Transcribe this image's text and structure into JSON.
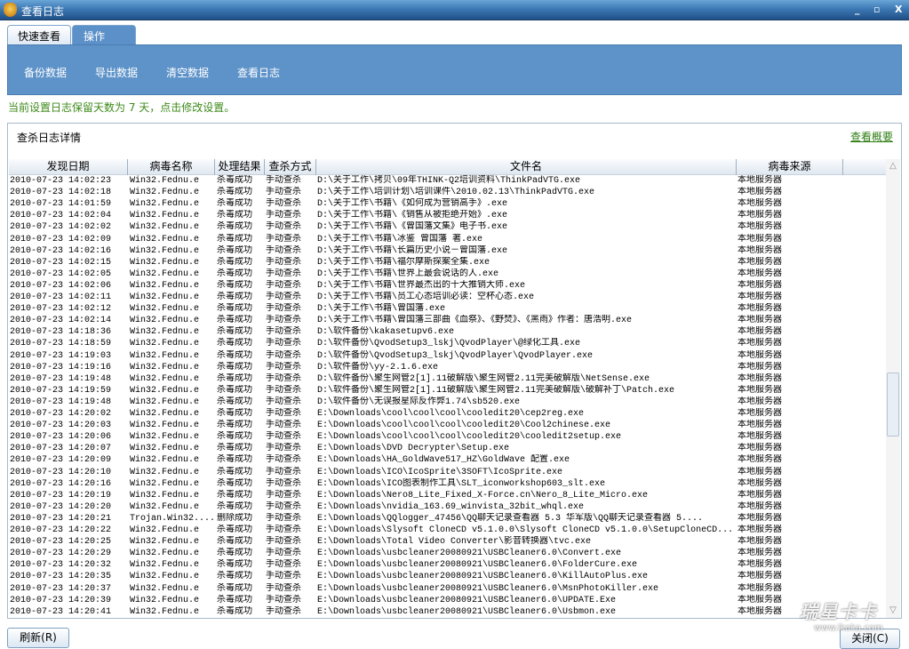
{
  "window": {
    "title": "查看日志",
    "minimize": "_",
    "restore": "▫",
    "close": "X"
  },
  "tabs": [
    {
      "label": "快速查看"
    },
    {
      "label": "操作"
    }
  ],
  "toolbar": [
    "备份数据",
    "导出数据",
    "清空数据",
    "查看日志"
  ],
  "notice": "当前设置日志保留天数为 7 天，点击修改设置。",
  "detail": {
    "title": "查杀日志详情",
    "summary_link": "查看概要"
  },
  "columns": [
    "发现日期",
    "病毒名称",
    "处理结果",
    "查杀方式",
    "文件名",
    "病毒来源"
  ],
  "rows": [
    [
      "2010-07-23 14:02:23",
      "Win32.Fednu.e",
      "杀毒成功",
      "手动查杀",
      "D:\\关于工作\\拷贝\\09年THINK-Q2培训资料\\ThinkPadVTG.exe",
      "本地服务器"
    ],
    [
      "2010-07-23 14:02:18",
      "Win32.Fednu.e",
      "杀毒成功",
      "手动查杀",
      "D:\\关于工作\\培训计划\\培训课件\\2010.02.13\\ThinkPadVTG.exe",
      "本地服务器"
    ],
    [
      "2010-07-23 14:01:59",
      "Win32.Fednu.e",
      "杀毒成功",
      "手动查杀",
      "D:\\关于工作\\书籍\\《如何成为营销高手》.exe",
      "本地服务器"
    ],
    [
      "2010-07-23 14:02:04",
      "Win32.Fednu.e",
      "杀毒成功",
      "手动查杀",
      "D:\\关于工作\\书籍\\《销售从被拒绝开始》.exe",
      "本地服务器"
    ],
    [
      "2010-07-23 14:02:02",
      "Win32.Fednu.e",
      "杀毒成功",
      "手动查杀",
      "D:\\关于工作\\书籍\\《曾国藩文集》电子书.exe",
      "本地服务器"
    ],
    [
      "2010-07-23 14:02:09",
      "Win32.Fednu.e",
      "杀毒成功",
      "手动查杀",
      "D:\\关于工作\\书籍\\冰鉴  曾国藩 著.exe",
      "本地服务器"
    ],
    [
      "2010-07-23 14:02:16",
      "Win32.Fednu.e",
      "杀毒成功",
      "手动查杀",
      "D:\\关于工作\\书籍\\长篇历史小说－曾国藩.exe",
      "本地服务器"
    ],
    [
      "2010-07-23 14:02:15",
      "Win32.Fednu.e",
      "杀毒成功",
      "手动查杀",
      "D:\\关于工作\\书籍\\福尔摩斯探案全集.exe",
      "本地服务器"
    ],
    [
      "2010-07-23 14:02:05",
      "Win32.Fednu.e",
      "杀毒成功",
      "手动查杀",
      "D:\\关于工作\\书籍\\世界上最会说话的人.exe",
      "本地服务器"
    ],
    [
      "2010-07-23 14:02:06",
      "Win32.Fednu.e",
      "杀毒成功",
      "手动查杀",
      "D:\\关于工作\\书籍\\世界最杰出的十大推销大师.exe",
      "本地服务器"
    ],
    [
      "2010-07-23 14:02:11",
      "Win32.Fednu.e",
      "杀毒成功",
      "手动查杀",
      "D:\\关于工作\\书籍\\员工心态培训必读：空杯心态.exe",
      "本地服务器"
    ],
    [
      "2010-07-23 14:02:12",
      "Win32.Fednu.e",
      "杀毒成功",
      "手动查杀",
      "D:\\关于工作\\书籍\\曾国藩.exe",
      "本地服务器"
    ],
    [
      "2010-07-23 14:02:14",
      "Win32.Fednu.e",
      "杀毒成功",
      "手动查杀",
      "D:\\关于工作\\书籍\\曾国藩三部曲《血祭》、《野焚》、《黑雨》作者：唐浩明.exe",
      "本地服务器"
    ],
    [
      "2010-07-23 14:18:36",
      "Win32.Fednu.e",
      "杀毒成功",
      "手动查杀",
      "D:\\软件备份\\kakasetupv6.exe",
      "本地服务器"
    ],
    [
      "2010-07-23 14:18:59",
      "Win32.Fednu.e",
      "杀毒成功",
      "手动查杀",
      "D:\\软件备份\\QvodSetup3_lskj\\QvodPlayer\\@绿化工具.exe",
      "本地服务器"
    ],
    [
      "2010-07-23 14:19:03",
      "Win32.Fednu.e",
      "杀毒成功",
      "手动查杀",
      "D:\\软件备份\\QvodSetup3_lskj\\QvodPlayer\\QvodPlayer.exe",
      "本地服务器"
    ],
    [
      "2010-07-23 14:19:16",
      "Win32.Fednu.e",
      "杀毒成功",
      "手动查杀",
      "D:\\软件备份\\yy-2.1.6.exe",
      "本地服务器"
    ],
    [
      "2010-07-23 14:19:48",
      "Win32.Fednu.e",
      "杀毒成功",
      "手动查杀",
      "D:\\软件备份\\聚生网管2[1].11破解版\\聚生网管2.11完美破解版\\NetSense.exe",
      "本地服务器"
    ],
    [
      "2010-07-23 14:19:59",
      "Win32.Fednu.e",
      "杀毒成功",
      "手动查杀",
      "D:\\软件备份\\聚生网管2[1].11破解版\\聚生网管2.11完美破解版\\破解补丁\\Patch.exe",
      "本地服务器"
    ],
    [
      "2010-07-23 14:19:48",
      "Win32.Fednu.e",
      "杀毒成功",
      "手动查杀",
      "D:\\软件备份\\无误报星际反作弊1.74\\sb520.exe",
      "本地服务器"
    ],
    [
      "2010-07-23 14:20:02",
      "Win32.Fednu.e",
      "杀毒成功",
      "手动查杀",
      "E:\\Downloads\\cool\\cool\\cool\\cooledit20\\cep2reg.exe",
      "本地服务器"
    ],
    [
      "2010-07-23 14:20:03",
      "Win32.Fednu.e",
      "杀毒成功",
      "手动查杀",
      "E:\\Downloads\\cool\\cool\\cool\\cooledit20\\Cool2chinese.exe",
      "本地服务器"
    ],
    [
      "2010-07-23 14:20:06",
      "Win32.Fednu.e",
      "杀毒成功",
      "手动查杀",
      "E:\\Downloads\\cool\\cool\\cool\\cooledit20\\cooledit2setup.exe",
      "本地服务器"
    ],
    [
      "2010-07-23 14:20:07",
      "Win32.Fednu.e",
      "杀毒成功",
      "手动查杀",
      "E:\\Downloads\\DVD Decrypter\\Setup.exe",
      "本地服务器"
    ],
    [
      "2010-07-23 14:20:09",
      "Win32.Fednu.e",
      "杀毒成功",
      "手动查杀",
      "E:\\Downloads\\HA_GoldWave517_HZ\\GoldWave 配置.exe",
      "本地服务器"
    ],
    [
      "2010-07-23 14:20:10",
      "Win32.Fednu.e",
      "杀毒成功",
      "手动查杀",
      "E:\\Downloads\\ICO\\IcoSprite\\3SOFT\\IcoSprite.exe",
      "本地服务器"
    ],
    [
      "2010-07-23 14:20:16",
      "Win32.Fednu.e",
      "杀毒成功",
      "手动查杀",
      "E:\\Downloads\\ICO图表制作工具\\SLT_iconworkshop603_slt.exe",
      "本地服务器"
    ],
    [
      "2010-07-23 14:20:19",
      "Win32.Fednu.e",
      "杀毒成功",
      "手动查杀",
      "E:\\Downloads\\Nero8_Lite_Fixed_X-Force.cn\\Nero_8_Lite_Micro.exe",
      "本地服务器"
    ],
    [
      "2010-07-23 14:20:20",
      "Win32.Fednu.e",
      "杀毒成功",
      "手动查杀",
      "E:\\Downloads\\nvidia_163.69_winvista_32bit_whql.exe",
      "本地服务器"
    ],
    [
      "2010-07-23 14:20:21",
      "Trojan.Win32....",
      "删除成功",
      "手动查杀",
      "E:\\Downloads\\QQlogger_47456\\QQ聊天记录查看器 5.3 华军版\\QQ聊天记录查看器 5....",
      "本地服务器"
    ],
    [
      "2010-07-23 14:20:22",
      "Win32.Fednu.e",
      "杀毒成功",
      "手动查杀",
      "E:\\Downloads\\Slysoft CloneCD v5.1.0.0\\Slysoft CloneCD v5.1.0.0\\SetupCloneCD...",
      "本地服务器"
    ],
    [
      "2010-07-23 14:20:25",
      "Win32.Fednu.e",
      "杀毒成功",
      "手动查杀",
      "E:\\Downloads\\Total Video Converter\\影音转换器\\tvc.exe",
      "本地服务器"
    ],
    [
      "2010-07-23 14:20:29",
      "Win32.Fednu.e",
      "杀毒成功",
      "手动查杀",
      "E:\\Downloads\\usbcleaner20080921\\USBCleaner6.0\\Convert.exe",
      "本地服务器"
    ],
    [
      "2010-07-23 14:20:32",
      "Win32.Fednu.e",
      "杀毒成功",
      "手动查杀",
      "E:\\Downloads\\usbcleaner20080921\\USBCleaner6.0\\FolderCure.exe",
      "本地服务器"
    ],
    [
      "2010-07-23 14:20:35",
      "Win32.Fednu.e",
      "杀毒成功",
      "手动查杀",
      "E:\\Downloads\\usbcleaner20080921\\USBCleaner6.0\\KillAutoPlus.exe",
      "本地服务器"
    ],
    [
      "2010-07-23 14:20:37",
      "Win32.Fednu.e",
      "杀毒成功",
      "手动查杀",
      "E:\\Downloads\\usbcleaner20080921\\USBCleaner6.0\\MsnPhotoKiller.exe",
      "本地服务器"
    ],
    [
      "2010-07-23 14:20:39",
      "Win32.Fednu.e",
      "杀毒成功",
      "手动查杀",
      "E:\\Downloads\\usbcleaner20080921\\USBCleaner6.0\\UPDATE.Exe",
      "本地服务器"
    ],
    [
      "2010-07-23 14:20:41",
      "Win32.Fednu.e",
      "杀毒成功",
      "手动查杀",
      "E:\\Downloads\\usbcleaner20080921\\USBCleaner6.0\\Usbmon.exe",
      "本地服务器"
    ]
  ],
  "buttons": {
    "refresh": "刷新(R)",
    "close": "关闭(C)"
  },
  "watermark": {
    "brand": "瑞星卡卡",
    "url": "www.ikaka.com"
  },
  "colors": {
    "accent": "#5e93c9",
    "notice": "#3d8a1a",
    "title_bar": "#2c6aa5"
  }
}
